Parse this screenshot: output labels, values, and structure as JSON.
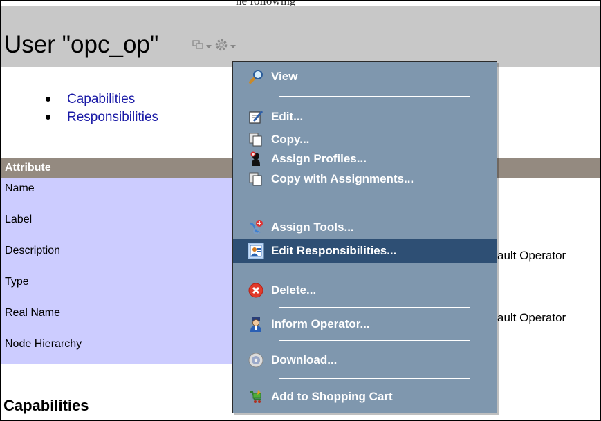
{
  "page": {
    "top_cut_text": "he following",
    "title": "User \"opc_op\"",
    "header_icons": [
      "window-icon",
      "chevron-down-icon",
      "gear-icon",
      "chevron-down-icon"
    ]
  },
  "links": [
    {
      "label": "Capabilities"
    },
    {
      "label": "Responsibilities"
    }
  ],
  "table": {
    "header": "Attribute",
    "rows": [
      {
        "attr": "Name",
        "value": ""
      },
      {
        "attr": "Label",
        "value": ""
      },
      {
        "attr": "Description",
        "value": "ault Operator"
      },
      {
        "attr": "Type",
        "value": ""
      },
      {
        "attr": "Real Name",
        "value": "ault Operator"
      },
      {
        "attr": "Node Hierarchy",
        "value": ""
      }
    ]
  },
  "section": {
    "title": "Capabilities"
  },
  "menu": {
    "highlight_color": "#2e4f74",
    "background_color": "#7f97ae",
    "items": [
      {
        "label": "View",
        "icon": "magnifier-icon"
      },
      {
        "label": "Edit...",
        "icon": "edit-icon"
      },
      {
        "label": "Copy...",
        "icon": "copy-icon"
      },
      {
        "label": "Assign Profiles...",
        "icon": "profile-icon"
      },
      {
        "label": "Copy with Assignments...",
        "icon": "copy-icon"
      },
      {
        "label": "Assign Tools...",
        "icon": "tools-icon"
      },
      {
        "label": "Edit Responsibilities...",
        "icon": "responsibilities-icon",
        "highlighted": true
      },
      {
        "label": "Delete...",
        "icon": "delete-icon"
      },
      {
        "label": "Inform Operator...",
        "icon": "operator-icon"
      },
      {
        "label": "Download...",
        "icon": "download-icon"
      },
      {
        "label": "Add to Shopping Cart",
        "icon": "cart-icon"
      }
    ]
  }
}
